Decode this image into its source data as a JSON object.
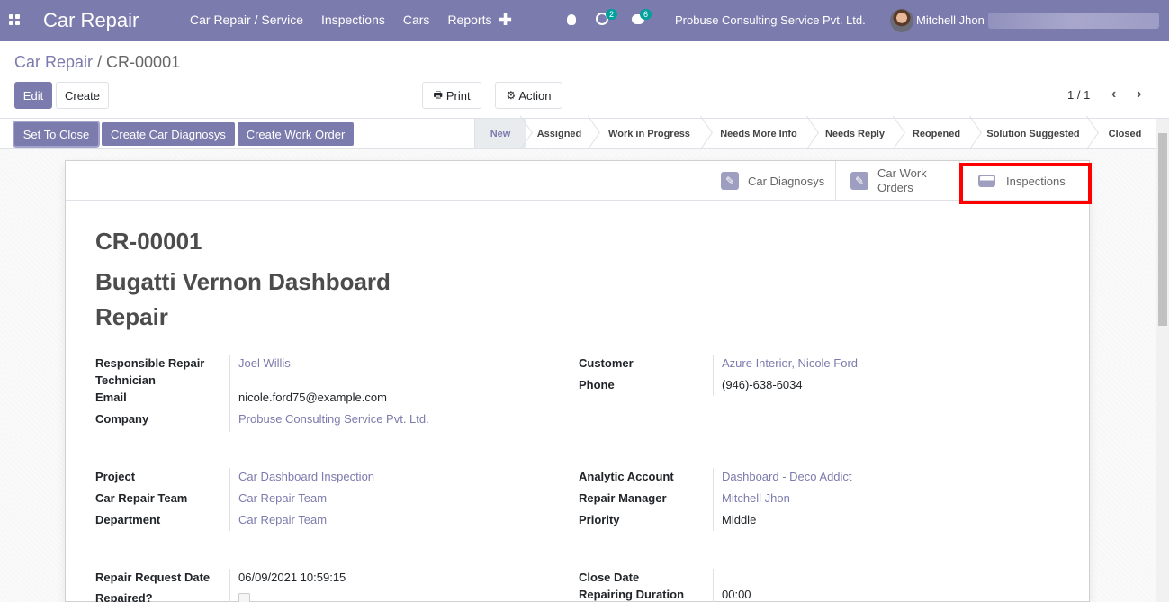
{
  "topbar": {
    "app_title": "Car Repair",
    "menu": [
      "Car Repair / Service",
      "Inspections",
      "Cars",
      "Reports"
    ],
    "plus_icon": "plus-icon",
    "activity_badge": "2",
    "messages_badge": "6",
    "company": "Probuse Consulting Service Pvt. Ltd.",
    "user": "Mitchell Jhon"
  },
  "breadcrumb": {
    "parent": "Car Repair",
    "separator": "/",
    "current": "CR-00001"
  },
  "buttons": {
    "edit": "Edit",
    "create": "Create",
    "print": "Print",
    "action": "Action"
  },
  "pager": {
    "value": "1 / 1"
  },
  "status_buttons": [
    "Set To Close",
    "Create Car Diagnosys",
    "Create Work Order"
  ],
  "stages": [
    "New",
    "Assigned",
    "Work in Progress",
    "Needs More Info",
    "Needs Reply",
    "Reopened",
    "Solution Suggested",
    "Closed"
  ],
  "active_stage": "New",
  "smart_buttons": {
    "diagnosys": "Car Diagnosys",
    "work_orders_line1": "Car Work",
    "work_orders_line2": "Orders",
    "inspections": "Inspections"
  },
  "record": {
    "id": "CR-00001",
    "name_line1": "Bugatti Vernon Dashboard",
    "name_line2": "Repair"
  },
  "fields": {
    "technician_label_1": "Responsible Repair",
    "technician_label_2": "Technician",
    "technician": "Joel Willis",
    "email_label": "Email",
    "email": "nicole.ford75@example.com",
    "company_label": "Company",
    "company": "Probuse Consulting Service Pvt. Ltd.",
    "customer_label": "Customer",
    "customer": "Azure Interior, Nicole Ford",
    "phone_label": "Phone",
    "phone": "(946)-638-6034",
    "project_label": "Project",
    "project": "Car Dashboard Inspection",
    "team_label": "Car Repair Team",
    "team": "Car Repair Team",
    "department_label": "Department",
    "department": "Car Repair Team",
    "analytic_label": "Analytic Account",
    "analytic": "Dashboard - Deco Addict",
    "manager_label": "Repair Manager",
    "manager": "Mitchell Jhon",
    "priority_label": "Priority",
    "priority": "Middle",
    "request_date_label": "Repair Request Date",
    "request_date": "06/09/2021 10:59:15",
    "repaired_label": "Repaired?",
    "close_date_label": "Close Date",
    "duration_label": "Repairing Duration",
    "duration": "00:00"
  },
  "colors": {
    "brand": "#7c7bad",
    "highlight": "#ff0000"
  }
}
